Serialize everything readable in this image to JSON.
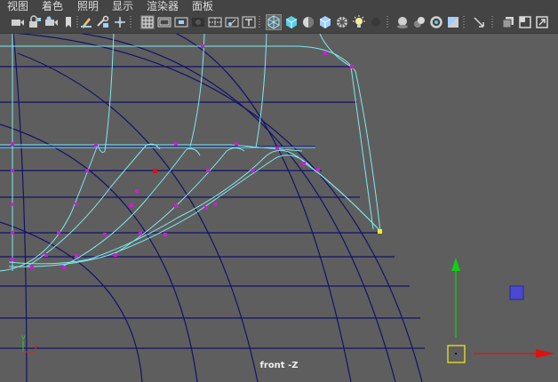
{
  "menu": [
    "视图",
    "着色",
    "照明",
    "显示",
    "渲染器",
    "面板"
  ],
  "toolbar": {
    "icons": [
      "camera-icon",
      "camera-lock-icon",
      "camera-attributes-icon",
      "bookmark-icon",
      "grease-pencil-icon",
      "film-gate-icon",
      "grid-icon",
      "film-gate-mask-icon",
      "resolution-gate-icon",
      "gate-mask-icon",
      "field-chart-icon",
      "safe-action-icon",
      "safe-title-icon",
      "wireframe-icon",
      "smooth-shade-icon",
      "lighting-icon",
      "textured-icon",
      "xray-icon",
      "default-light-icon",
      "shadows-icon",
      "isolate-select-icon",
      "xray-joints-icon",
      "xray-active-icon",
      "two-sided-icon",
      "depth-peel-icon",
      "panel-layout-icon",
      "panel-single-icon"
    ]
  },
  "viewport": {
    "label": "front -Z",
    "axis": {
      "x": "x",
      "y": "y"
    },
    "colors": {
      "background": "#5e5e5e",
      "grid": "#12126a",
      "curve": "#7fe9ee",
      "vertex": "#d01ad8",
      "selected_vertex": "#e01010",
      "active_point": "#f2f21a",
      "manip_x": "#e01010",
      "manip_y": "#10d010",
      "manip_z": "#4a4ad0"
    }
  }
}
